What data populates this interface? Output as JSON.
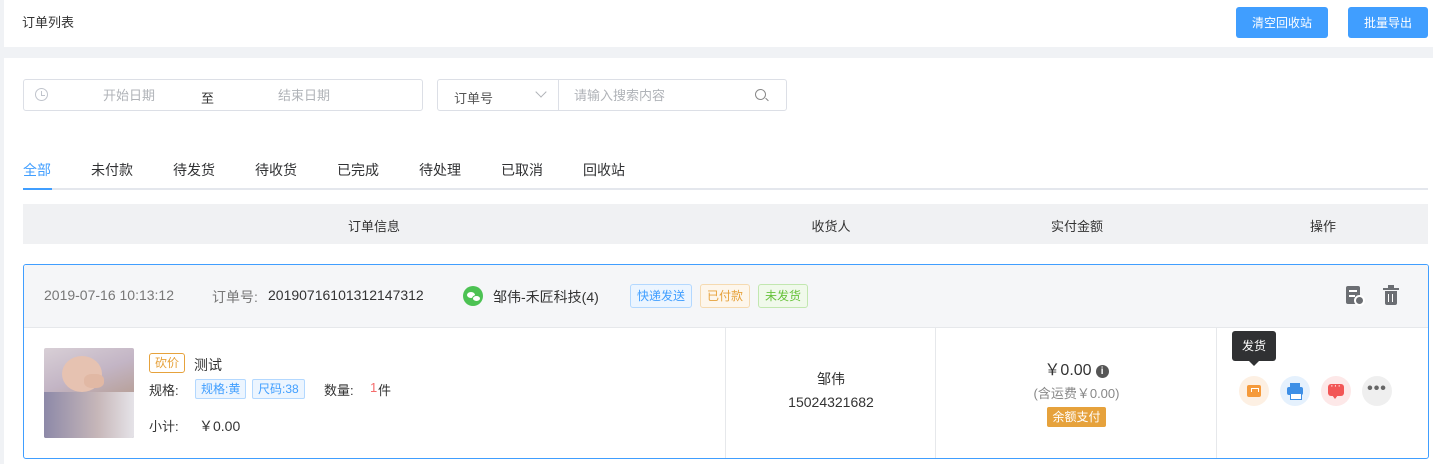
{
  "header": {
    "title": "订单列表",
    "clear_recycle_label": "清空回收站",
    "batch_export_label": "批量导出"
  },
  "filters": {
    "start_date_placeholder": "开始日期",
    "range_separator": "至",
    "end_date_placeholder": "结束日期",
    "search_field_selected": "订单号",
    "search_placeholder": "请输入搜索内容"
  },
  "tabs": [
    {
      "label": "全部",
      "active": true
    },
    {
      "label": "未付款"
    },
    {
      "label": "待发货"
    },
    {
      "label": "待收货"
    },
    {
      "label": "已完成"
    },
    {
      "label": "待处理"
    },
    {
      "label": "已取消"
    },
    {
      "label": "回收站"
    }
  ],
  "table_headers": {
    "order_info": "订单信息",
    "receiver": "收货人",
    "paid_amount": "实付金额",
    "actions": "操作"
  },
  "order": {
    "datetime": "2019-07-16 10:13:12",
    "order_no_label": "订单号:",
    "order_no": "2019071610131214731 2",
    "buyer": "邹伟-禾匠科技(4)",
    "tags": {
      "delivery": "快递发送",
      "paid": "已付款",
      "unshipped": "未发货"
    },
    "product": {
      "badge": "砍价",
      "name": "测试",
      "spec_label": "规格:",
      "specs": [
        "规格:黄",
        "尺码:38"
      ],
      "qty_label": "数量:",
      "qty": "1",
      "qty_unit": "件",
      "subtotal_label": "小计:",
      "subtotal": "￥0.00"
    },
    "receiver": {
      "name": "邹伟",
      "phone": "15024321682"
    },
    "payment": {
      "amount": "￥0.00",
      "shipping_note": "(含运费￥0.00)",
      "method": "余额支付"
    },
    "tooltip": "发货"
  },
  "icons": {
    "header": [
      "document-ban-icon",
      "trash-icon"
    ],
    "actions": [
      "ship-icon",
      "print-icon",
      "message-icon",
      "more-icon"
    ]
  },
  "colors": {
    "primary": "#409eff",
    "warning": "#e6a23c",
    "success": "#67c23a",
    "danger": "#f56c6c"
  }
}
